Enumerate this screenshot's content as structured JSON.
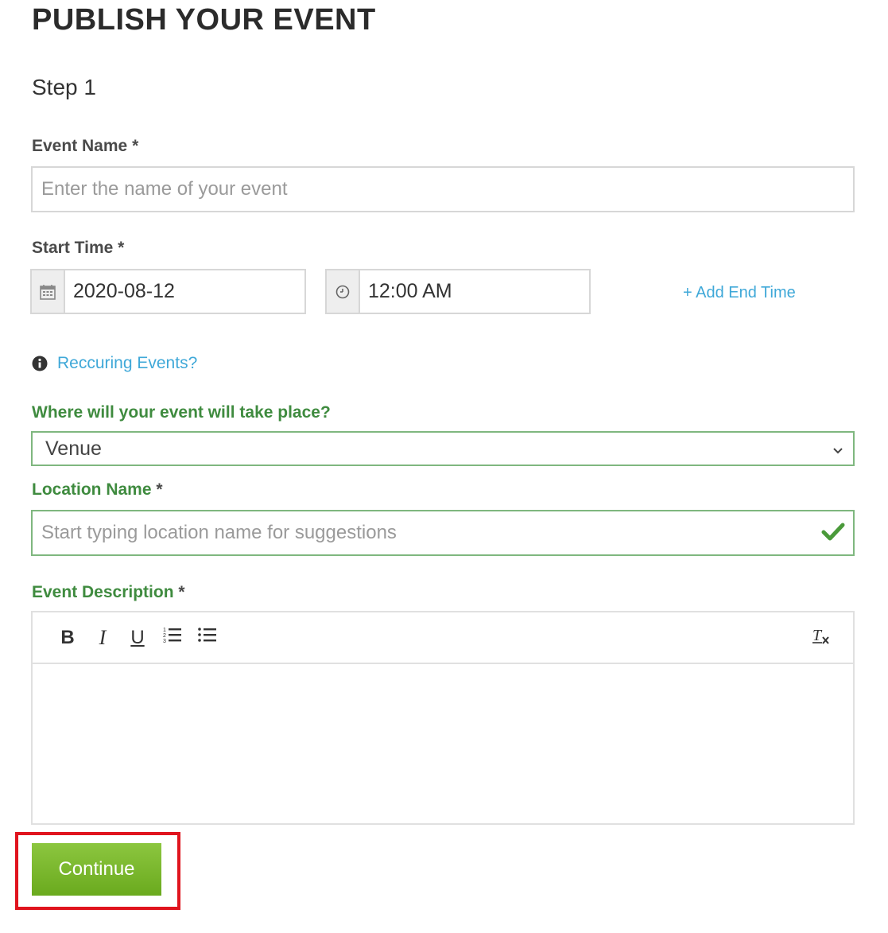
{
  "page": {
    "title": "PUBLISH YOUR EVENT",
    "step": "Step 1"
  },
  "form": {
    "event_name": {
      "label": "Event Name",
      "required": "*",
      "placeholder": "Enter the name of your event"
    },
    "start_time": {
      "label": "Start Time",
      "required": "*",
      "date_value": "2020-08-12",
      "time_value": "12:00 AM",
      "add_end_time": "+ Add End Time"
    },
    "recurring_link": "Reccuring Events?",
    "venue_question": "Where will your event will take place?",
    "venue_select": {
      "selected": "Venue"
    },
    "location_name": {
      "label": "Location Name",
      "required": "*",
      "placeholder": "Start typing location name for suggestions"
    },
    "description": {
      "label": "Event Description",
      "required": "*",
      "toolbar": {
        "bold": "B",
        "italic": "I",
        "underline": "U",
        "ordered_list": "ordered-list-icon",
        "bullet_list": "bullet-list-icon",
        "clear_format": "clear-format-icon"
      }
    },
    "continue_label": "Continue"
  },
  "colors": {
    "accent_green": "#3f8b3f",
    "button_green": "#7ab52c",
    "link_blue": "#3fa8d8",
    "highlight_red": "#e0141e"
  }
}
